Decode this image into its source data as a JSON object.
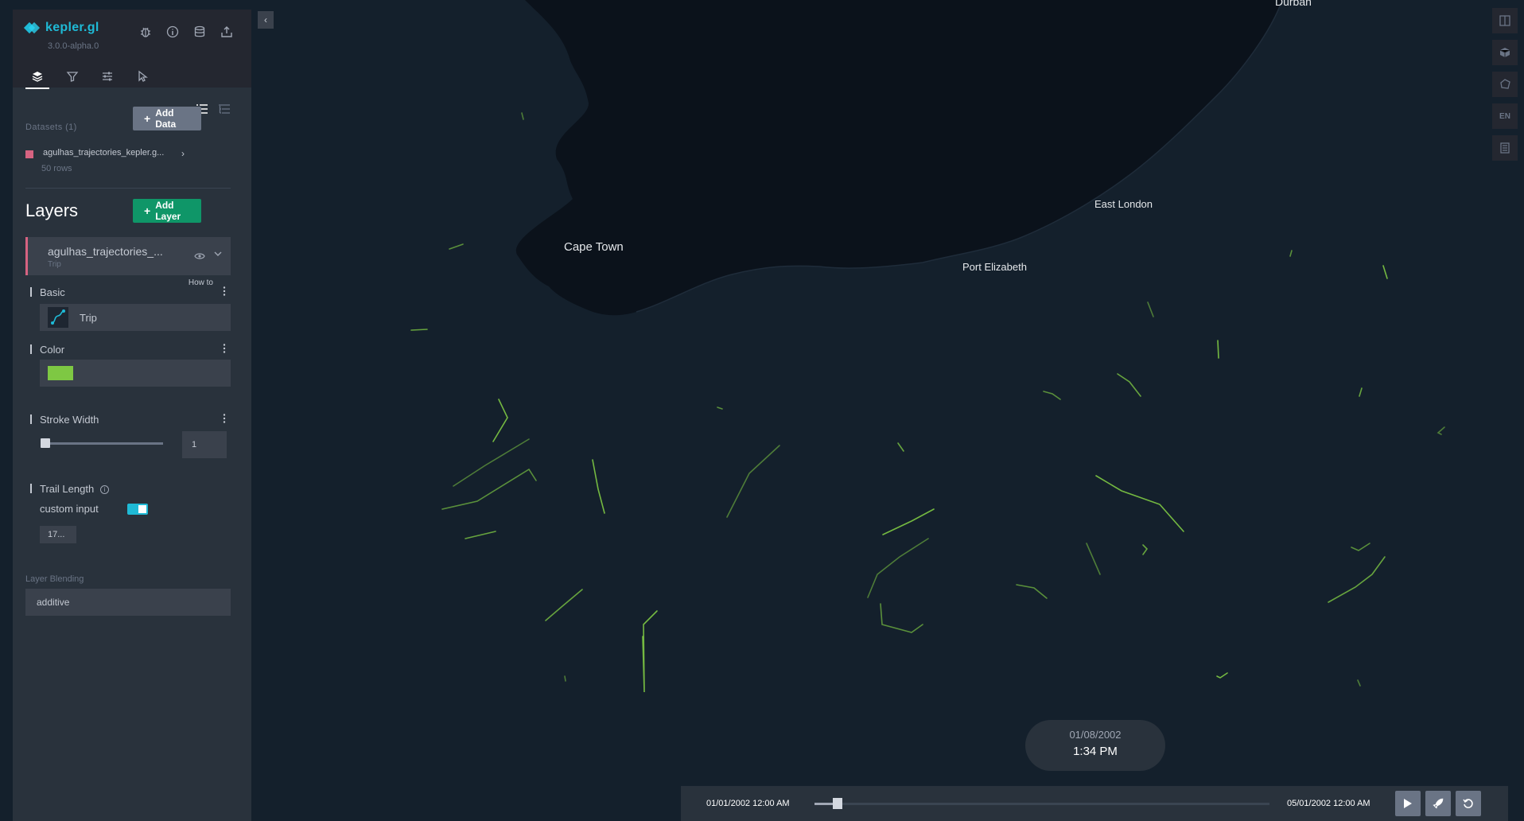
{
  "app": {
    "name": "kepler.gl",
    "version": "3.0.0-alpha.0"
  },
  "header": {
    "icons": [
      "bug-icon",
      "info-icon",
      "database-icon",
      "share-icon"
    ]
  },
  "tabs": [
    {
      "name": "layers",
      "icon": "layers-icon",
      "active": true
    },
    {
      "name": "filters",
      "icon": "filter-icon",
      "active": false
    },
    {
      "name": "interactions",
      "icon": "sliders-icon",
      "active": false
    },
    {
      "name": "base-map",
      "icon": "cursor-icon",
      "active": false
    }
  ],
  "datasets": {
    "label": "Datasets (1)",
    "add_button": "Add Data",
    "items": [
      {
        "name": "agulhas_trajectories_kepler.g...",
        "rows": "50 rows",
        "color": "#d66381"
      }
    ]
  },
  "layers": {
    "title": "Layers",
    "add_button": "Add Layer",
    "items": [
      {
        "name": "agulhas_trajectories_...",
        "type": "Trip",
        "color": "#d66381"
      }
    ]
  },
  "layer_config": {
    "how_to": "How to",
    "basic": {
      "title": "Basic",
      "type_label": "Trip"
    },
    "color": {
      "title": "Color",
      "value": "#7ec843"
    },
    "stroke_width": {
      "title": "Stroke Width",
      "value": "1",
      "slider_fraction": 0.0
    },
    "trail_length": {
      "title": "Trail Length",
      "custom_label": "custom input",
      "value": "17..."
    },
    "blending": {
      "label": "Layer Blending",
      "value": "additive"
    }
  },
  "map": {
    "cities": [
      "Durban",
      "East London",
      "Cape Town",
      "Port Elizabeth"
    ],
    "land_color": "#0b121b",
    "sea_color": "#14202c",
    "trajectory_color": "#7ec843"
  },
  "map_controls": [
    "split-map-icon",
    "3d-view-icon",
    "draw-polygon-icon",
    "EN",
    "legend-icon"
  ],
  "time": {
    "current_date": "01/08/2002",
    "current_time": "1:34 PM",
    "start": "01/01/2002 12:00 AM",
    "end": "05/01/2002 12:00 AM",
    "progress_fraction": 0.05
  }
}
